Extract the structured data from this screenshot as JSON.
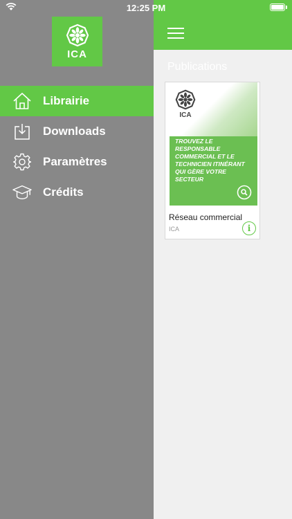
{
  "status": {
    "time": "12:25 PM"
  },
  "drawer": {
    "logo_text": "ICA",
    "items": [
      {
        "label": "Librairie",
        "icon": "home-icon",
        "active": true
      },
      {
        "label": "Downloads",
        "icon": "download-icon",
        "active": false
      },
      {
        "label": "Paramètres",
        "icon": "gear-icon",
        "active": false
      },
      {
        "label": "Crédits",
        "icon": "graduation-cap-icon",
        "active": false
      }
    ]
  },
  "content": {
    "section_title": "Publications",
    "publications": [
      {
        "cover_brand": "ICA",
        "cover_text": "TROUVEZ LE RESPONSABLE COMMERCIAL ET LE TECHNICIEN ITINÉRANT QUI GÈRE VOTRE SECTEUR",
        "title": "Réseau commercial",
        "publisher": "ICA",
        "info_label": "i"
      }
    ]
  },
  "colors": {
    "accent": "#62c846",
    "drawer_bg": "#888888",
    "content_bg": "#f0f0f0"
  }
}
